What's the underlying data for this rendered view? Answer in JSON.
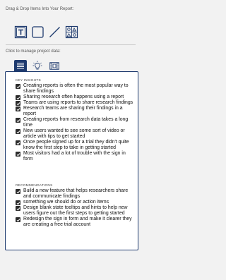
{
  "drag_drop_label": "Drag & Drop Items Into Your Report:",
  "tools": [
    {
      "name": "text-block-tool-icon"
    },
    {
      "name": "rectangle-tool-icon"
    },
    {
      "name": "line-tool-icon"
    },
    {
      "name": "image-grid-tool-icon"
    }
  ],
  "manage_label": "Click to manage project data:",
  "tabs": [
    {
      "name": "tab-list-data",
      "icon": "list-lines-icon",
      "active": true
    },
    {
      "name": "tab-insights",
      "icon": "lightbulb-icon",
      "active": false
    },
    {
      "name": "tab-media",
      "icon": "film-strip-icon",
      "active": false
    }
  ],
  "panel": {
    "key_insights": {
      "title": "KEY INSIGHTS",
      "items": [
        {
          "text": "Creating reports is often the most popular way to share findings",
          "checked": true
        },
        {
          "text": "Sharing research often happens using a report",
          "checked": true
        },
        {
          "text": "Teams are using reports to share research findings",
          "checked": true
        },
        {
          "text": "Research teams are sharing their findings in a report",
          "checked": true
        },
        {
          "text": "Creating reports from research data takes a long time",
          "checked": true
        },
        {
          "text": "New users wanted to see some sort of video or article with tips to get started",
          "checked": true
        },
        {
          "text": "Once people signed up for a trial they didn't quite know the first step to take in getting started",
          "checked": true
        },
        {
          "text": "Most visitors had a lot of trouble with the sign in form",
          "checked": true
        }
      ]
    },
    "recommendations": {
      "title": "RECOMMENDATIONS",
      "items": [
        {
          "text": "Build a new feature that helps researchers share and communicate findings",
          "checked": true
        },
        {
          "text": "something we should do or action items",
          "checked": true
        },
        {
          "text": "Design blank state tooltips and hints to help new users figure out the first steps to getting started",
          "checked": true
        },
        {
          "text": "Redesign the sign in form and make it clearer they are creating a free trial account",
          "checked": true
        }
      ]
    }
  },
  "colors": {
    "accent": "#1e3a6e",
    "checkbox": "#2d2d2d",
    "background": "#f2f2f2",
    "panel": "#ffffff"
  }
}
